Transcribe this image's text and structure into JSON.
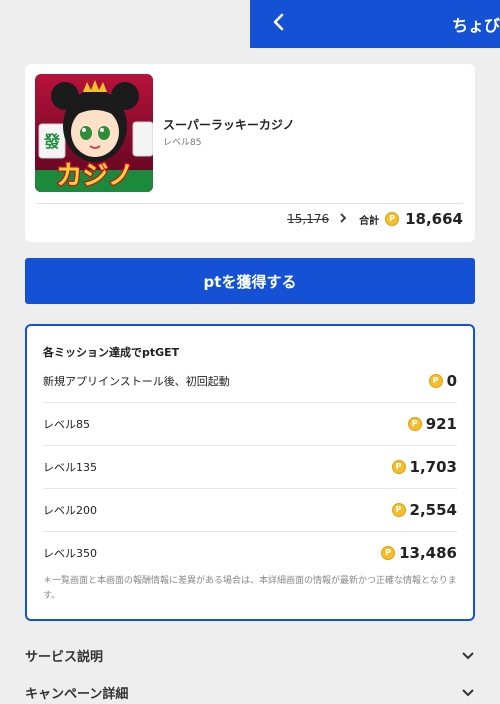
{
  "header": {
    "title": "ちょび",
    "back_icon": "chevron-left-icon",
    "background_color": "#1451d4"
  },
  "app": {
    "name": "スーパーラッキーカジノ",
    "level": "レベル85",
    "icon_text": "カジノ",
    "old_points": "15,176",
    "total_label": "合計",
    "total_points": "18,664"
  },
  "coin_symbol": "P",
  "get_button_label": "ptを獲得する",
  "missions": {
    "title": "各ミッション達成でptGET",
    "items": [
      {
        "label": "新規アプリインストール後、初回起動",
        "points": "0"
      },
      {
        "label": "レベル85",
        "points": "921"
      },
      {
        "label": "レベル135",
        "points": "1,703"
      },
      {
        "label": "レベル200",
        "points": "2,554"
      },
      {
        "label": "レベル350",
        "points": "13,486"
      }
    ],
    "note": "＊一覧画面と本画面の報酬情報に差異がある場合は、本詳細画面の情報が最新かつ正確な情報となります。"
  },
  "sections": [
    {
      "label": "サービス説明"
    },
    {
      "label": "キャンペーン詳細"
    }
  ]
}
